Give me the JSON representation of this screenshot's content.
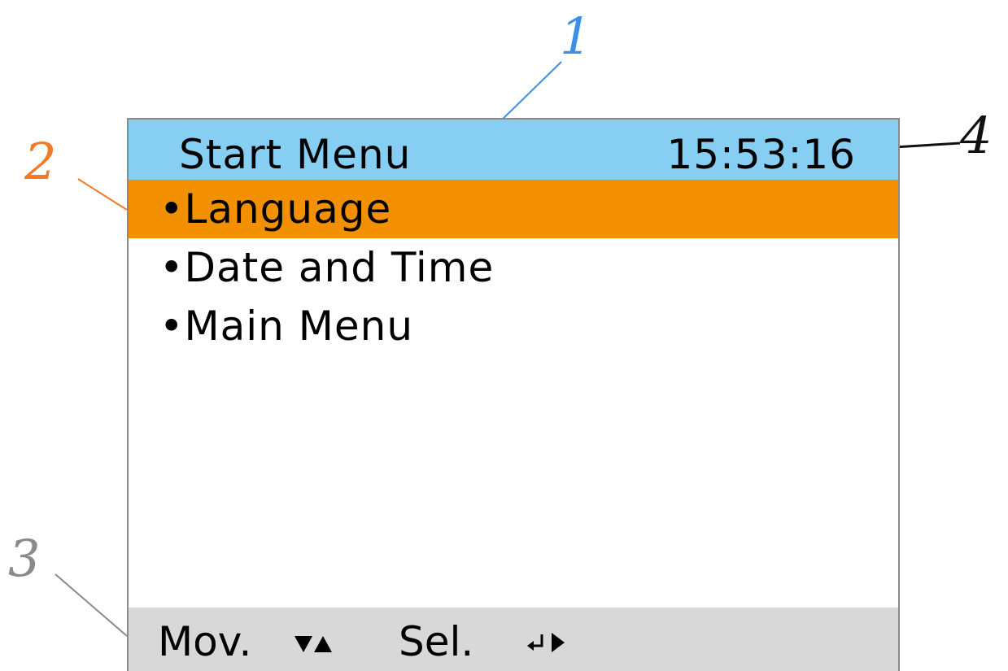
{
  "screen": {
    "header": {
      "title": "Start Menu",
      "clock": "15:53:16"
    },
    "menu": {
      "items": [
        {
          "label": "•Language",
          "selected": true
        },
        {
          "label": "•Date and Time",
          "selected": false
        },
        {
          "label": "•Main Menu",
          "selected": false
        }
      ]
    },
    "status_bar": {
      "move_label": "Mov.",
      "move_icon": "down-up-arrows-icon",
      "select_label": "Sel.",
      "select_icon": "enter-right-arrow-icon"
    }
  },
  "callouts": [
    {
      "number": "1",
      "color": "#3c8fe6"
    },
    {
      "number": "2",
      "color": "#f07a2a"
    },
    {
      "number": "3",
      "color": "#8a8a8a"
    },
    {
      "number": "4",
      "color": "#111111"
    }
  ],
  "colors": {
    "header_bg": "#87cef3",
    "selected_bg": "#f29000",
    "status_bg": "#d8d8d8",
    "border": "#8a8a8a"
  }
}
